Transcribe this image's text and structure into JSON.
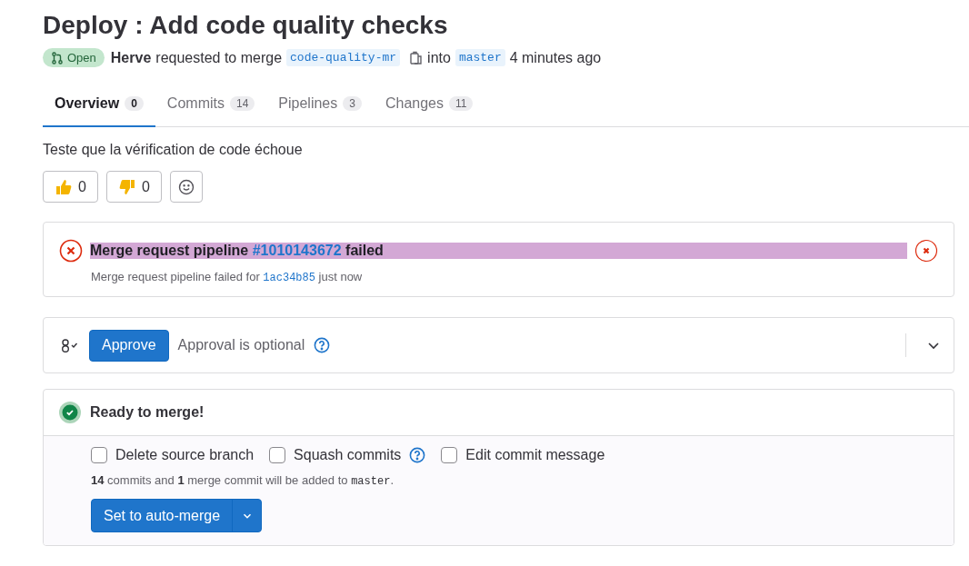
{
  "title": "Deploy : Add code quality checks",
  "meta": {
    "status": "Open",
    "author": "Herve",
    "action": "requested to merge",
    "source_branch": "code-quality-mr",
    "into": "into",
    "target_branch": "master",
    "time": "4 minutes ago"
  },
  "tabs": [
    {
      "label": "Overview",
      "count": "0",
      "selected": true
    },
    {
      "label": "Commits",
      "count": "14",
      "selected": false
    },
    {
      "label": "Pipelines",
      "count": "3",
      "selected": false
    },
    {
      "label": "Changes",
      "count": "11",
      "selected": false
    }
  ],
  "description": "Teste que la vérification de code échoue",
  "reactions": [
    {
      "kind": "thumbs-up",
      "count": "0"
    },
    {
      "kind": "thumbs-down",
      "count": "0"
    },
    {
      "kind": "add"
    }
  ],
  "pipeline": {
    "title_before": "Merge request pipeline ",
    "link": "#1010143672",
    "title_after": " failed",
    "highlighted": true,
    "sub_before": "Merge request pipeline failed for ",
    "commit": "1ac34b85",
    "sub_after": " just now"
  },
  "approval": {
    "button": "Approve",
    "text": "Approval is optional",
    "expanded": false
  },
  "merge": {
    "status": "Ready to merge!",
    "options": [
      {
        "label": "Delete source branch",
        "checked": false,
        "help": false
      },
      {
        "label": "Squash commits",
        "checked": false,
        "help": true
      },
      {
        "label": "Edit commit message",
        "checked": false,
        "help": false
      }
    ],
    "info_before": "**14** commits and **1** merge commit will be added to ",
    "info_branch": "master",
    "info_after": ".",
    "button": "Set to auto-merge"
  }
}
